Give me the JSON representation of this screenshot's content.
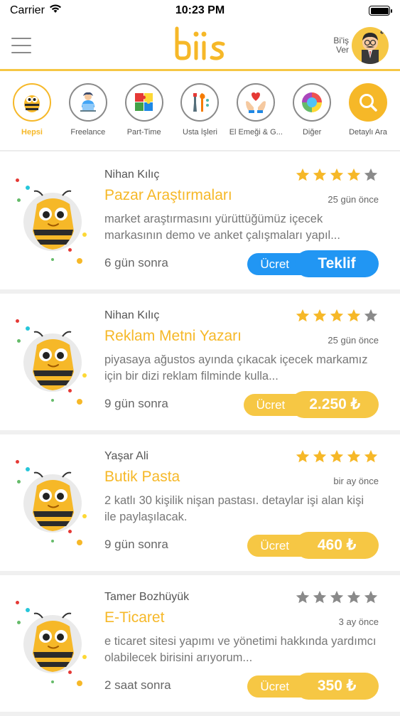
{
  "status_bar": {
    "carrier": "Carrier",
    "time": "10:23 PM"
  },
  "header": {
    "logo_text": "biis",
    "post_label": "Bi'iş Ver"
  },
  "categories": [
    {
      "label": "Hepsi",
      "icon": "bee-icon",
      "active": true
    },
    {
      "label": "Freelance",
      "icon": "laptop-person-icon"
    },
    {
      "label": "Part-Time",
      "icon": "puzzle-icon"
    },
    {
      "label": "Usta İşleri",
      "icon": "tools-icon"
    },
    {
      "label": "El Emeği & G...",
      "icon": "hands-heart-icon"
    },
    {
      "label": "Diğer",
      "icon": "pie-icon"
    },
    {
      "label": "Detaylı Ara",
      "icon": "search-icon"
    }
  ],
  "jobs": [
    {
      "name": "Nihan Kılıç",
      "rating": 4,
      "title": "Pazar Araştırmaları",
      "ago": "25 gün önce",
      "description": "market araştırmasını yürüttüğümüz içecek markasının demo ve anket çalışmaları yapıl...",
      "deadline": "6 gün sonra",
      "fee_label": "Ücret",
      "fee_value": "Teklif",
      "fee_color": "#2196f3"
    },
    {
      "name": "Nihan Kılıç",
      "rating": 4,
      "title": "Reklam Metni Yazarı",
      "ago": "25 gün önce",
      "description": "piyasaya ağustos ayında çıkacak içecek markamız için bir dizi reklam filminde kulla...",
      "deadline": "9 gün sonra",
      "fee_label": "Ücret",
      "fee_value": "2.250 ₺",
      "fee_color": "#f6c744"
    },
    {
      "name": "Yaşar Ali",
      "rating": 5,
      "title": "Butik Pasta",
      "ago": "bir ay önce",
      "description": "2 katlı 30 kişilik nişan pastası. detaylar işi alan kişi ile paylaşılacak.",
      "deadline": "9 gün sonra",
      "fee_label": "Ücret",
      "fee_value": "460 ₺",
      "fee_color": "#f6c744"
    },
    {
      "name": "Tamer Bozhüyük",
      "rating": 0,
      "title": "E-Ticaret",
      "ago": "3 ay önce",
      "description": "e ticaret sitesi yapımı ve yönetimi hakkında yardımcı olabilecek birisini arıyorum...",
      "deadline": "2 saat sonra",
      "fee_label": "Ücret",
      "fee_value": "350 ₺",
      "fee_color": "#f6c744"
    }
  ],
  "colors": {
    "accent": "#f6b828",
    "blue": "#2196f3",
    "star_on": "#f6b828",
    "star_off": "#8a8a8a"
  }
}
